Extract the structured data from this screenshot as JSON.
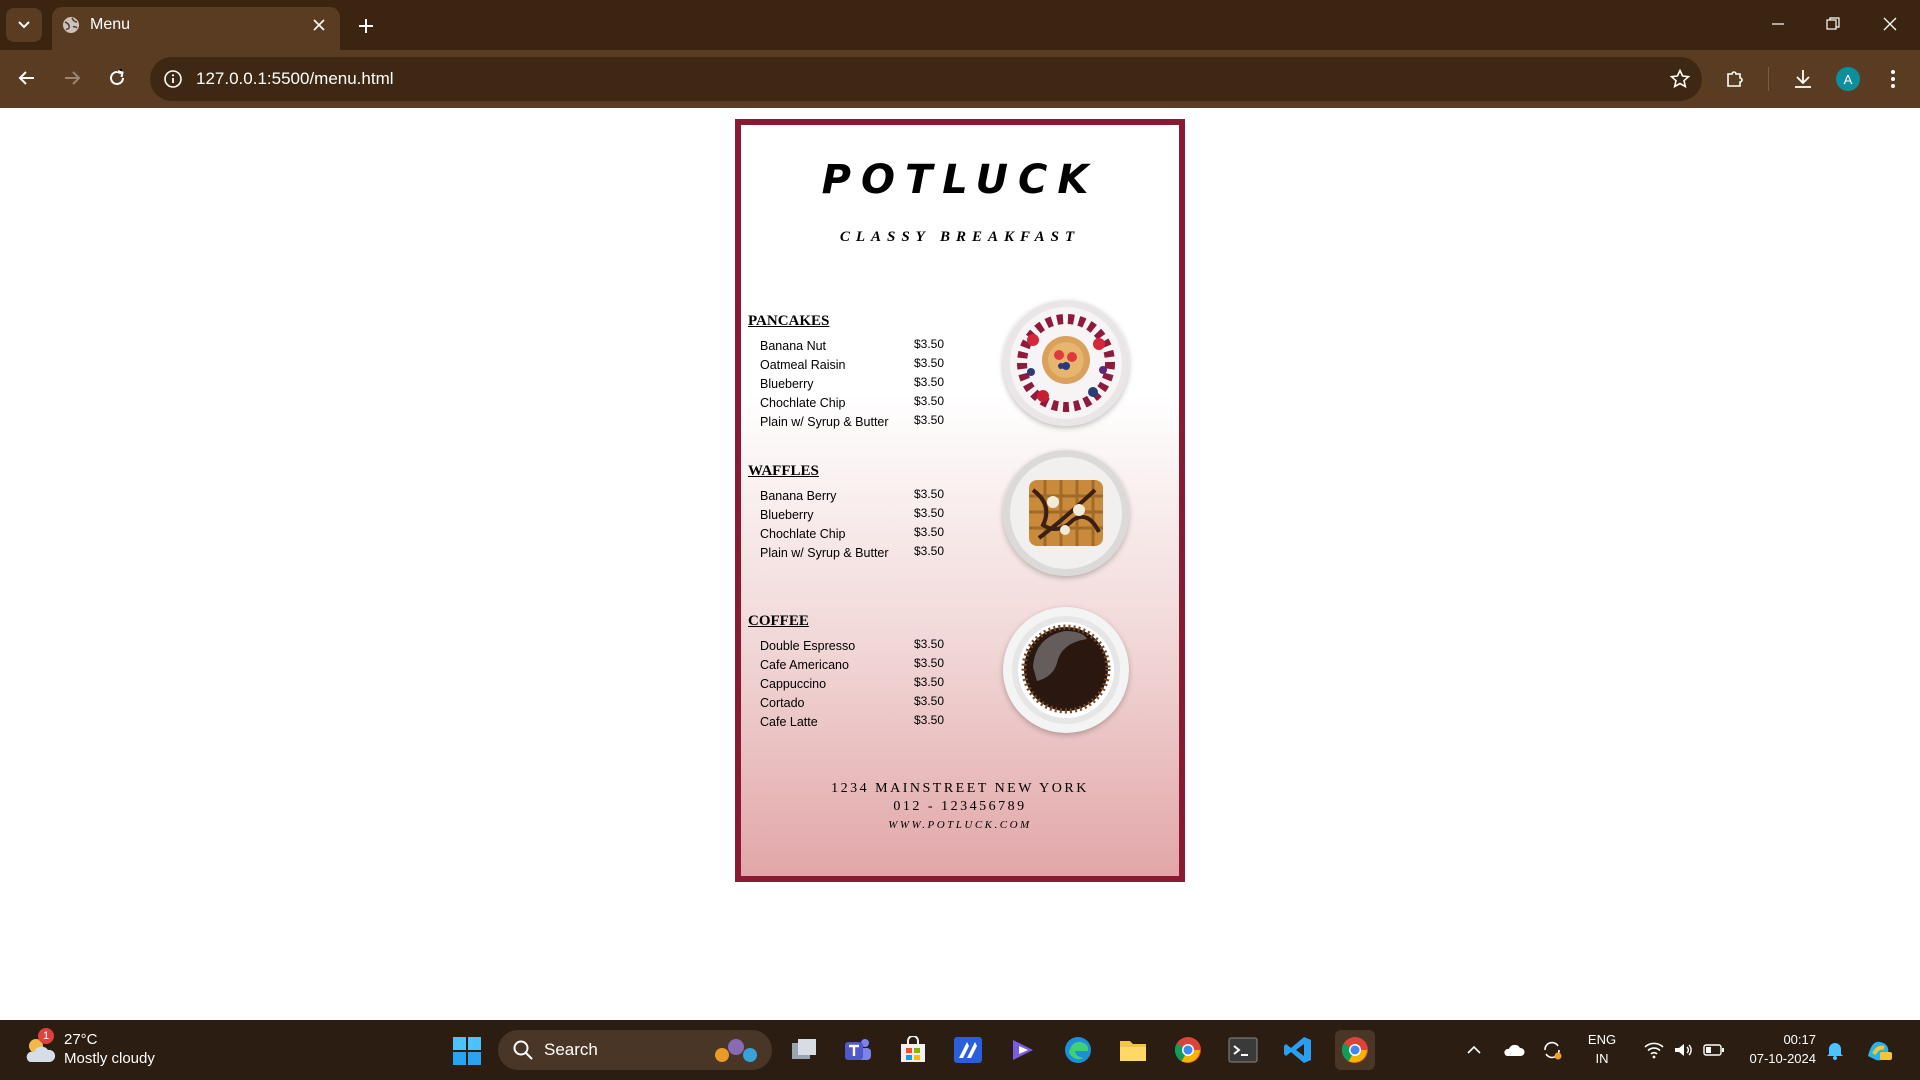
{
  "browser": {
    "tab_title": "Menu",
    "url": "127.0.0.1:5500/menu.html",
    "profile_initial": "A"
  },
  "menu": {
    "brand": "POTLUCK",
    "tagline": "CLASSY BREAKFAST",
    "sections": [
      {
        "title": "PANCAKES",
        "items": [
          {
            "name": "Banana Nut",
            "price": "$3.50"
          },
          {
            "name": "Oatmeal Raisin",
            "price": "$3.50"
          },
          {
            "name": "Blueberry",
            "price": "$3.50"
          },
          {
            "name": "Chochlate Chip",
            "price": "$3.50"
          },
          {
            "name": "Plain w/ Syrup & Butter",
            "price": "$3.50"
          }
        ]
      },
      {
        "title": "WAFFLES",
        "items": [
          {
            "name": "Banana Berry",
            "price": "$3.50"
          },
          {
            "name": "Blueberry",
            "price": "$3.50"
          },
          {
            "name": "Chochlate Chip",
            "price": "$3.50"
          },
          {
            "name": "Plain w/ Syrup & Butter",
            "price": "$3.50"
          }
        ]
      },
      {
        "title": "COFFEE",
        "items": [
          {
            "name": "Double Espresso",
            "price": "$3.50"
          },
          {
            "name": "Cafe Americano",
            "price": "$3.50"
          },
          {
            "name": "Cappuccino",
            "price": "$3.50"
          },
          {
            "name": "Cortado",
            "price": "$3.50"
          },
          {
            "name": "Cafe Latte",
            "price": "$3.50"
          }
        ]
      }
    ],
    "footer": {
      "address": "1234 MAINSTREET NEW YORK",
      "phone": "012 - 123456789",
      "website": "WWW.POTLUCK.COM"
    }
  },
  "taskbar": {
    "weather_temp": "27°C",
    "weather_condition": "Mostly cloudy",
    "weather_badge": "1",
    "search_label": "Search",
    "language": "ENG",
    "region": "IN",
    "time": "00:17",
    "date": "07-10-2024"
  },
  "colors": {
    "chrome_dark": "#3b2410",
    "chrome_toolbar": "#5a3c22",
    "card_border": "#8a1a33",
    "card_gradient_end": "#e2a6a8",
    "taskbar": "#2b1d12"
  }
}
